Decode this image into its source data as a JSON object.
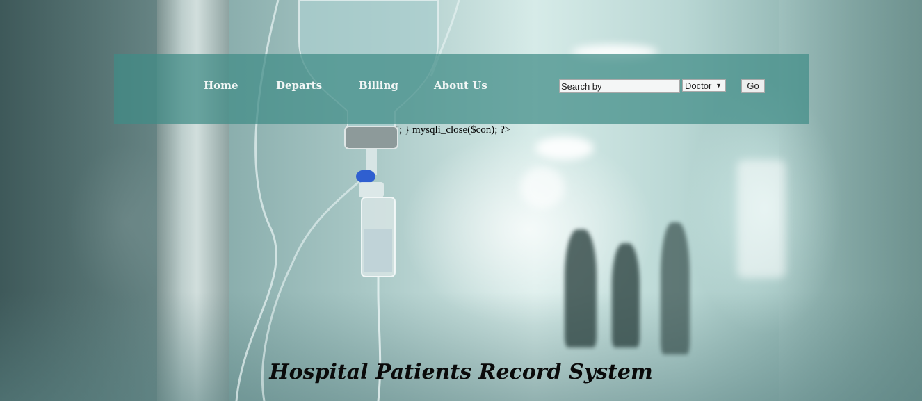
{
  "nav": {
    "items": [
      {
        "label": "Home"
      },
      {
        "label": "Departs"
      },
      {
        "label": "Billing"
      },
      {
        "label": "About Us"
      }
    ]
  },
  "search": {
    "placeholder": "Search by",
    "value": "",
    "select_value": "Doctor",
    "go_label": "Go"
  },
  "stray_text": "\"; } mysqli_close($con); ?>",
  "title": "Hospital Patients Record System",
  "icons": {
    "select_arrow": "chevron-down-icon"
  },
  "colors": {
    "navbar_bg": "#408c86",
    "nav_text": "#f2f7f6",
    "title_text": "#0a0a0a"
  }
}
